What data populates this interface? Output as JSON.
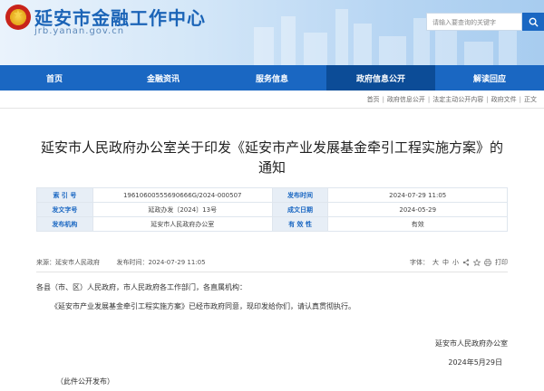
{
  "header": {
    "site_title": "延安市金融工作中心",
    "site_domain": "jrb.yanan.gov.cn",
    "search_placeholder": "请输入要查询的关键字"
  },
  "nav": [
    {
      "label": "首页",
      "active": false
    },
    {
      "label": "金融资讯",
      "active": false
    },
    {
      "label": "服务信息",
      "active": false
    },
    {
      "label": "政府信息公开",
      "active": true
    },
    {
      "label": "解读回应",
      "active": false
    }
  ],
  "breadcrumb": [
    "首页",
    "政府信息公开",
    "法定主动公开内容",
    "政府文件",
    "正文"
  ],
  "article": {
    "title_line1": "延安市人民政府办公室关于印发《延安市产业发展基金牵引工程实施方案》的",
    "title_line2": "通知"
  },
  "info": {
    "index_label": "索 引 号",
    "index_value": "19610600555690666G/2024-000507",
    "publish_label": "发布时间",
    "publish_value": "2024-07-29 11:05",
    "doc_label": "发文字号",
    "doc_value": "延政办发〔2024〕13号",
    "date_label": "成文日期",
    "date_value": "2024-05-29",
    "org_label": "发布机构",
    "org_value": "延安市人民政府办公室",
    "valid_label": "有 效 性",
    "valid_value": "有效"
  },
  "meta": {
    "source": "来源：延安市人民政府",
    "time": "发布时间：2024-07-29 11:05",
    "font_label": "字体：",
    "font_large": "大",
    "font_medium": "中",
    "font_small": "小",
    "print_label": "打印"
  },
  "body": {
    "salutation": "各县（市、区）人民政府，市人民政府各工作部门，各直属机构：",
    "paragraph1": "《延安市产业发展基金牵引工程实施方案》已经市政府同意，现印发给你们，请认真贯彻执行。",
    "signature": "延安市人民政府办公室",
    "date": "2024年5月29日",
    "note": "（此件公开发布）"
  },
  "colors": {
    "primary": "#1a67c2",
    "nav_active": "#0c4c97",
    "key_bg": "#e7eef6"
  }
}
